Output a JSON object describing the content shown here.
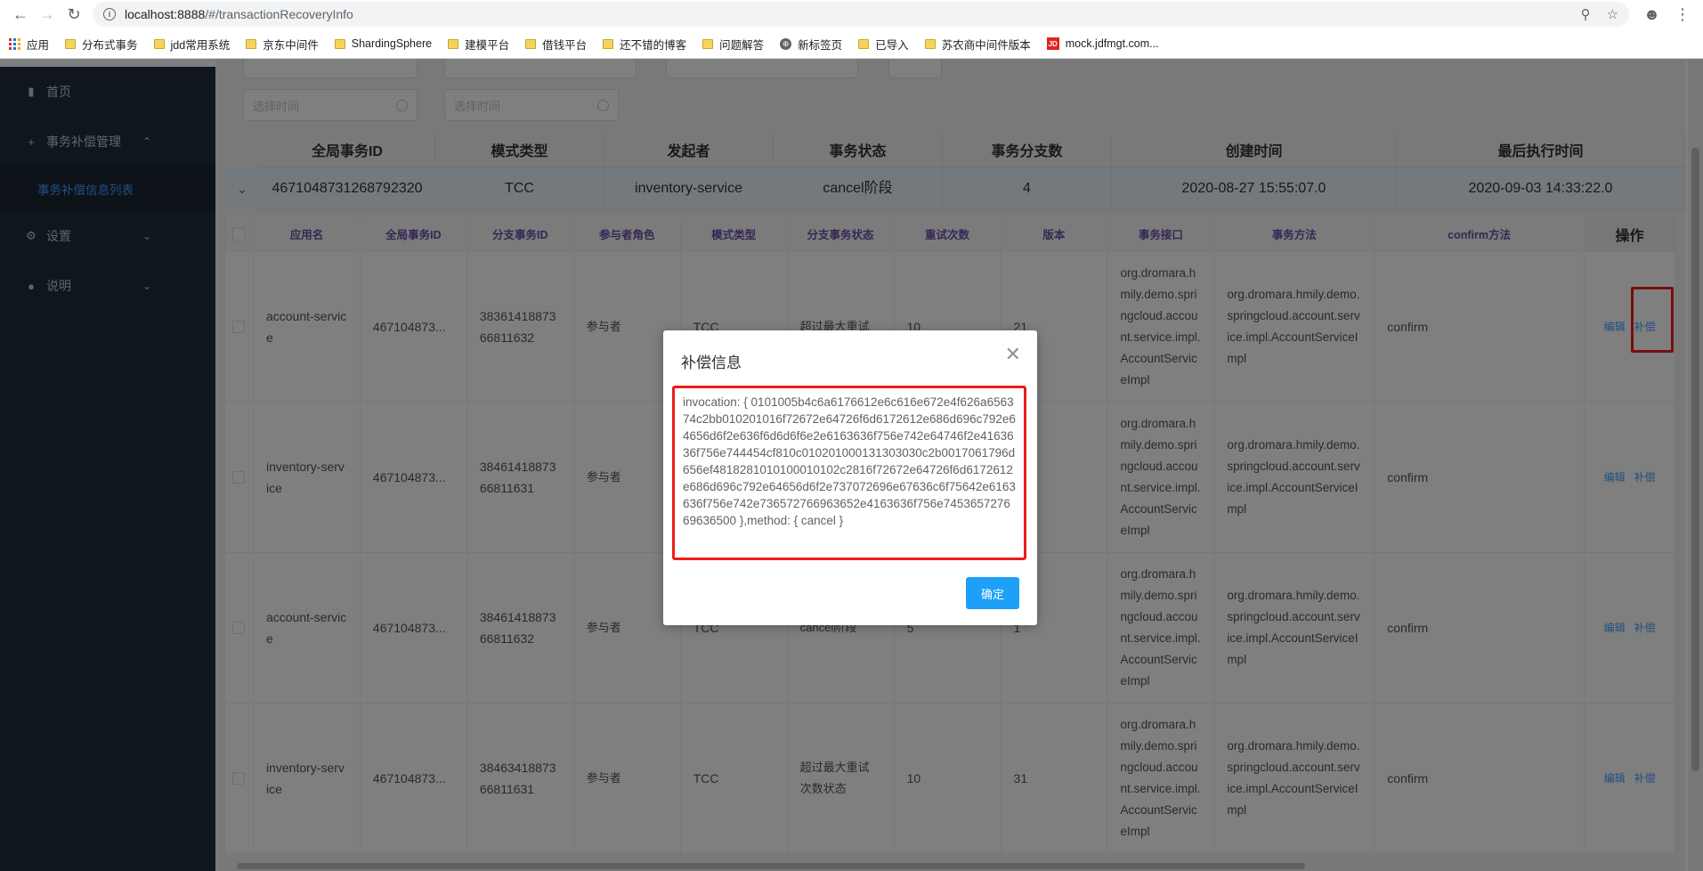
{
  "browser": {
    "url_host": "localhost:8888",
    "url_path": "/#/transactionRecoveryInfo",
    "bookmarks": [
      "应用",
      "分布式事务",
      "jdd常用系统",
      "京东中间件",
      "ShardingSphere",
      "建模平台",
      "借钱平台",
      "还不错的博客",
      "问题解答",
      "新标签页",
      "已导入",
      "苏农商中间件版本",
      "mock.jdfmgt.com..."
    ]
  },
  "sidebar": {
    "home": "首页",
    "tx_mgmt": "事务补偿管理",
    "tx_list": "事务补偿信息列表",
    "settings": "设置",
    "help": "说明"
  },
  "filters": {
    "time_placeholder": "选择时间"
  },
  "outer_table": {
    "headers": [
      "全局事务ID",
      "模式类型",
      "发起者",
      "事务状态",
      "事务分支数",
      "创建时间",
      "最后执行时间"
    ],
    "row": [
      "4671048731268792320",
      "TCC",
      "inventory-service",
      "cancel阶段",
      "4",
      "2020-08-27 15:55:07.0",
      "2020-09-03 14:33:22.0"
    ]
  },
  "inner_table": {
    "headers": [
      "应用名",
      "全局事务ID",
      "分支事务ID",
      "参与者角色",
      "模式类型",
      "分支事务状态",
      "重试次数",
      "版本",
      "事务接口",
      "事务方法",
      "confirm方法",
      "操作"
    ],
    "action_edit": "编辑",
    "action_compensate": "补偿",
    "rows": [
      {
        "app": "account-service",
        "global_id": "467104873...",
        "branch_id": "3836141887366811632",
        "role": "参与者",
        "mode": "TCC",
        "status": "超过最大重试",
        "retry": "10",
        "version": "21",
        "interface": "org.dromara.hmily.demo.springcloud.account.service.impl.AccountServiceImpl",
        "method": "org.dromara.hmily.demo.springcloud.account.service.impl.AccountServiceImpl",
        "confirm": "confirm"
      },
      {
        "app": "inventory-service",
        "global_id": "467104873...",
        "branch_id": "3846141887366811631",
        "role": "参与者",
        "mode": "",
        "status": "",
        "retry": "",
        "version": "",
        "interface": "org.dromara.hmily.demo.springcloud.account.service.impl.AccountServiceImpl",
        "method": "org.dromara.hmily.demo.springcloud.account.service.impl.AccountServiceImpl",
        "confirm": "confirm"
      },
      {
        "app": "account-service",
        "global_id": "467104873...",
        "branch_id": "3846141887366811632",
        "role": "参与者",
        "mode": "TCC",
        "status": "cancel阶段",
        "retry": "5",
        "version": "1",
        "interface": "org.dromara.hmily.demo.springcloud.account.service.impl.AccountServiceImpl",
        "method": "org.dromara.hmily.demo.springcloud.account.service.impl.AccountServiceImpl",
        "confirm": "confirm"
      },
      {
        "app": "inventory-service",
        "global_id": "467104873...",
        "branch_id": "3846341887366811631",
        "role": "参与者",
        "mode": "TCC",
        "status": "超过最大重试次数状态",
        "retry": "10",
        "version": "31",
        "interface": "org.dromara.hmily.demo.springcloud.account.service.impl.AccountServiceImpl",
        "method": "org.dromara.hmily.demo.springcloud.account.service.impl.AccountServiceImpl",
        "confirm": "confirm"
      }
    ]
  },
  "modal": {
    "title": "补偿信息",
    "body": "invocation: { 0101005b4c6a6176612e6c616e672e4f626a656374c2bb010201016f72672e64726f6d6172612e686d696c792e64656d6f2e636f6d6d6f6e2e6163636f756e742e64746f2e4163636f756e744454cf810c010201000131303030c2b0017061796d656ef4818281010100010102c2816f72672e64726f6d6172612e686d696c792e64656d6f2e737072696e67636c6f75642e6163636f756e742e736572766963652e4163636f756e745365727669636500 },method: { cancel }",
    "ok_label": "确定"
  }
}
